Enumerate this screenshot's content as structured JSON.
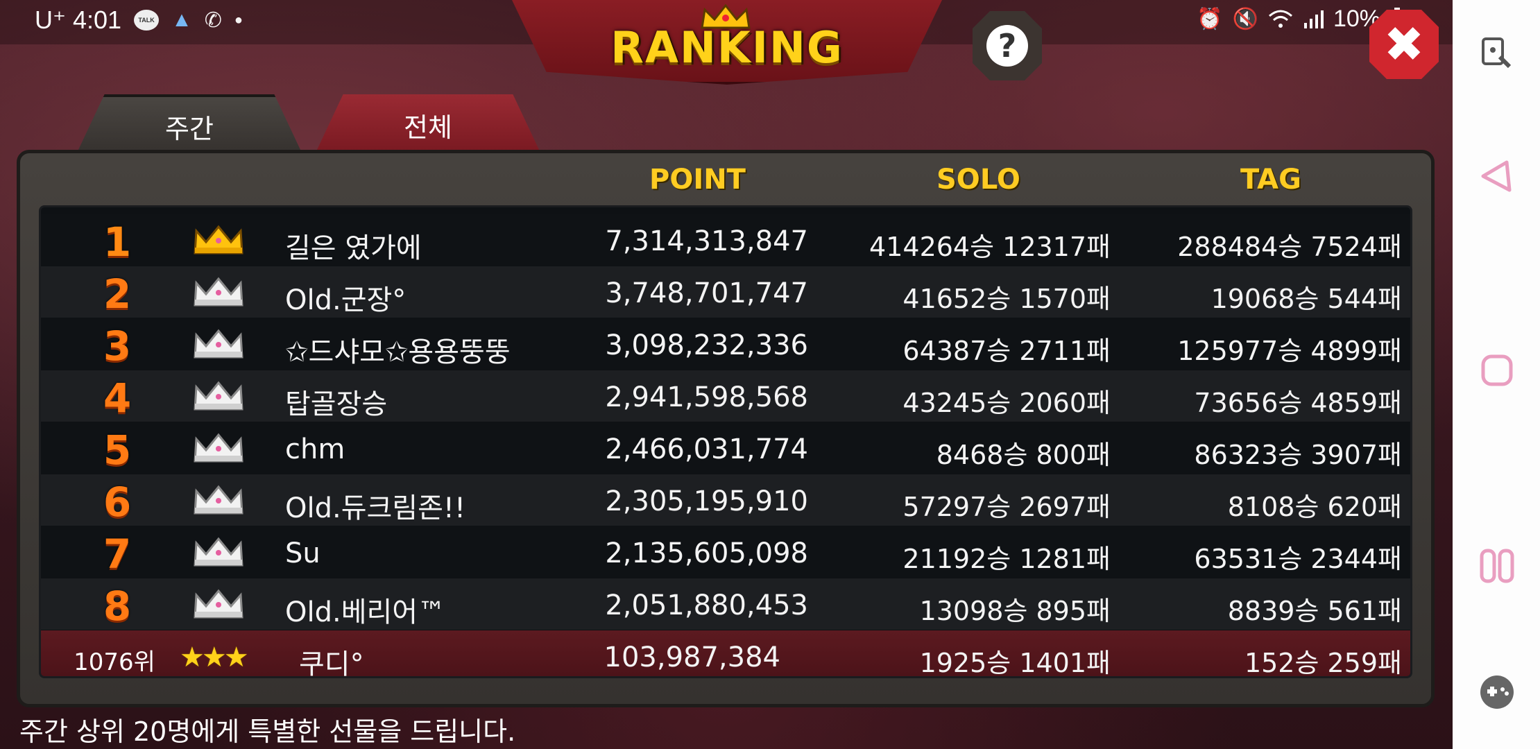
{
  "status_bar": {
    "carrier_time": "U⁺ 4:01",
    "battery": "10%",
    "icons": [
      "kakaotalk-icon",
      "arrow-app-icon",
      "whowho-call-icon",
      "dot-icon",
      "alarm-icon",
      "mute-icon",
      "wifi-icon",
      "signal-icon",
      "battery-icon"
    ]
  },
  "header": {
    "title": "RANKING",
    "help_label": "?",
    "close_label": "✖"
  },
  "tabs": [
    {
      "label": "주간",
      "active": true
    },
    {
      "label": "전체",
      "active": false
    }
  ],
  "columns": {
    "point": "POINT",
    "solo": "SOLO",
    "tag": "TAG"
  },
  "rows": [
    {
      "rank": "1",
      "name": "길은 였가에",
      "point": "7,314,313,847",
      "solo": "414264승 12317패",
      "tag": "288484승 7524패"
    },
    {
      "rank": "2",
      "name": "Old.군장°",
      "point": "3,748,701,747",
      "solo": "41652승 1570패",
      "tag": "19068승 544패"
    },
    {
      "rank": "3",
      "name": "✩드샤모✩용용뚱뚱",
      "point": "3,098,232,336",
      "solo": "64387승 2711패",
      "tag": "125977승 4899패"
    },
    {
      "rank": "4",
      "name": "탑골장승",
      "point": "2,941,598,568",
      "solo": "43245승 2060패",
      "tag": "73656승 4859패"
    },
    {
      "rank": "5",
      "name": "chm",
      "point": "2,466,031,774",
      "solo": "8468승 800패",
      "tag": "86323승 3907패"
    },
    {
      "rank": "6",
      "name": "Old.듀크림존!!",
      "point": "2,305,195,910",
      "solo": "57297승 2697패",
      "tag": "8108승 620패"
    },
    {
      "rank": "7",
      "name": "Su",
      "point": "2,135,605,098",
      "solo": "21192승 1281패",
      "tag": "63531승 2344패"
    },
    {
      "rank": "8",
      "name": "Old.베리어™",
      "point": "2,051,880,453",
      "solo": "13098승 895패",
      "tag": "8839승 561패"
    }
  ],
  "my_row": {
    "rank": "1076위",
    "stars": "★★★",
    "name": "_쿠디°",
    "point": "103,987,384",
    "solo": "1925승 1401패",
    "tag": "152승 259패"
  },
  "footer": "주간 상위 20명에게 특별한 선물을 드립니다.",
  "colors": {
    "title": "#ffd21a",
    "column_header": "#ffcc22",
    "rank_number": "#ff7a14",
    "my_row_bg": "#5c1a20",
    "nav_icon": "#e8a0c0"
  }
}
